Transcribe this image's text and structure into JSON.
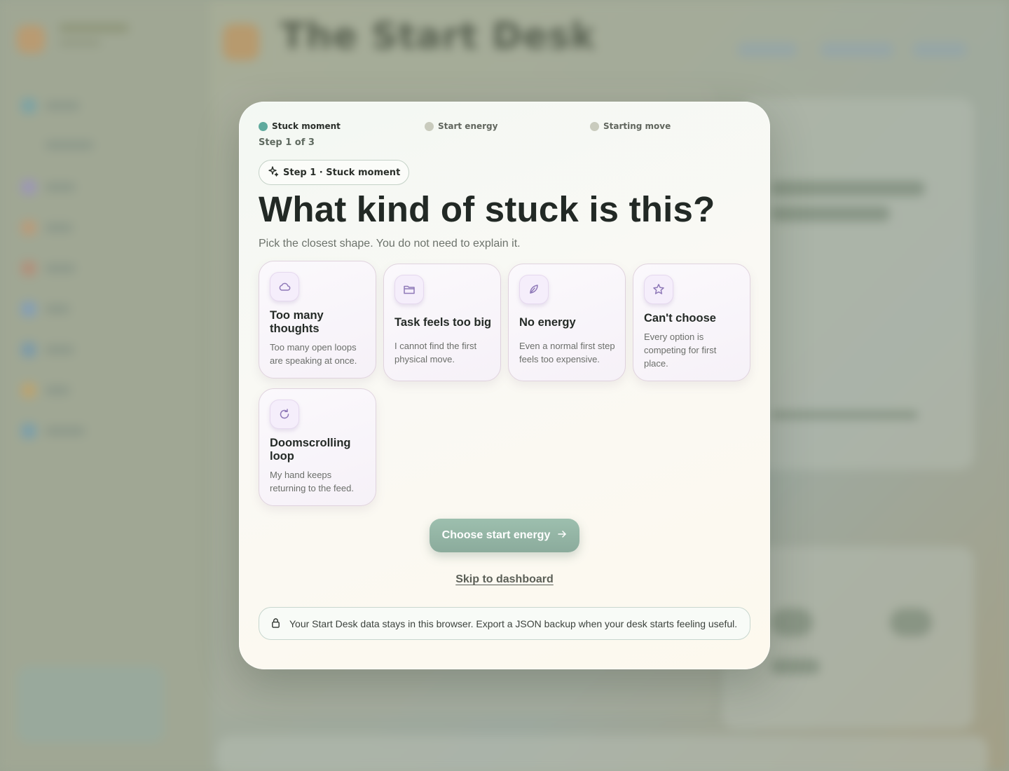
{
  "background": {
    "app_title": "The Start Desk"
  },
  "progress": {
    "steps": [
      {
        "label": "Stuck moment",
        "state": "active"
      },
      {
        "label": "Start energy",
        "state": "upcoming"
      },
      {
        "label": "Starting move",
        "state": "upcoming"
      }
    ],
    "step_count": "Step 1 of 3"
  },
  "chip": {
    "label": "Step 1 · Stuck moment",
    "icon": "sparkle-icon"
  },
  "headline": "What kind of stuck is this?",
  "subhead": "Pick the closest shape. You do not need to explain it.",
  "options": [
    {
      "title": "Too many thoughts",
      "desc": "Too many open loops are speaking at once.",
      "icon": "cloud-icon"
    },
    {
      "title": "Task feels too big",
      "desc": "I cannot find the first physical move.",
      "icon": "folder-icon"
    },
    {
      "title": "No energy",
      "desc": "Even a normal first step feels too expensive.",
      "icon": "leaf-icon"
    },
    {
      "title": "Can't choose",
      "desc": "Every option is competing for first place.",
      "icon": "star-icon"
    },
    {
      "title": "Doomscrolling loop",
      "desc": "My hand keeps returning to the feed.",
      "icon": "refresh-icon"
    }
  ],
  "cta": {
    "label": "Choose start energy",
    "icon": "arrow-right-icon"
  },
  "skip_label": "Skip to dashboard",
  "privacy_note": "Your Start Desk data stays in this browser. Export a JSON backup when your desk starts feeling useful.",
  "colors": {
    "accent": "#5faa9d",
    "cta": "#8fb0a0",
    "card_border": "#e0d3de",
    "icon_stroke": "#8f79b8"
  }
}
